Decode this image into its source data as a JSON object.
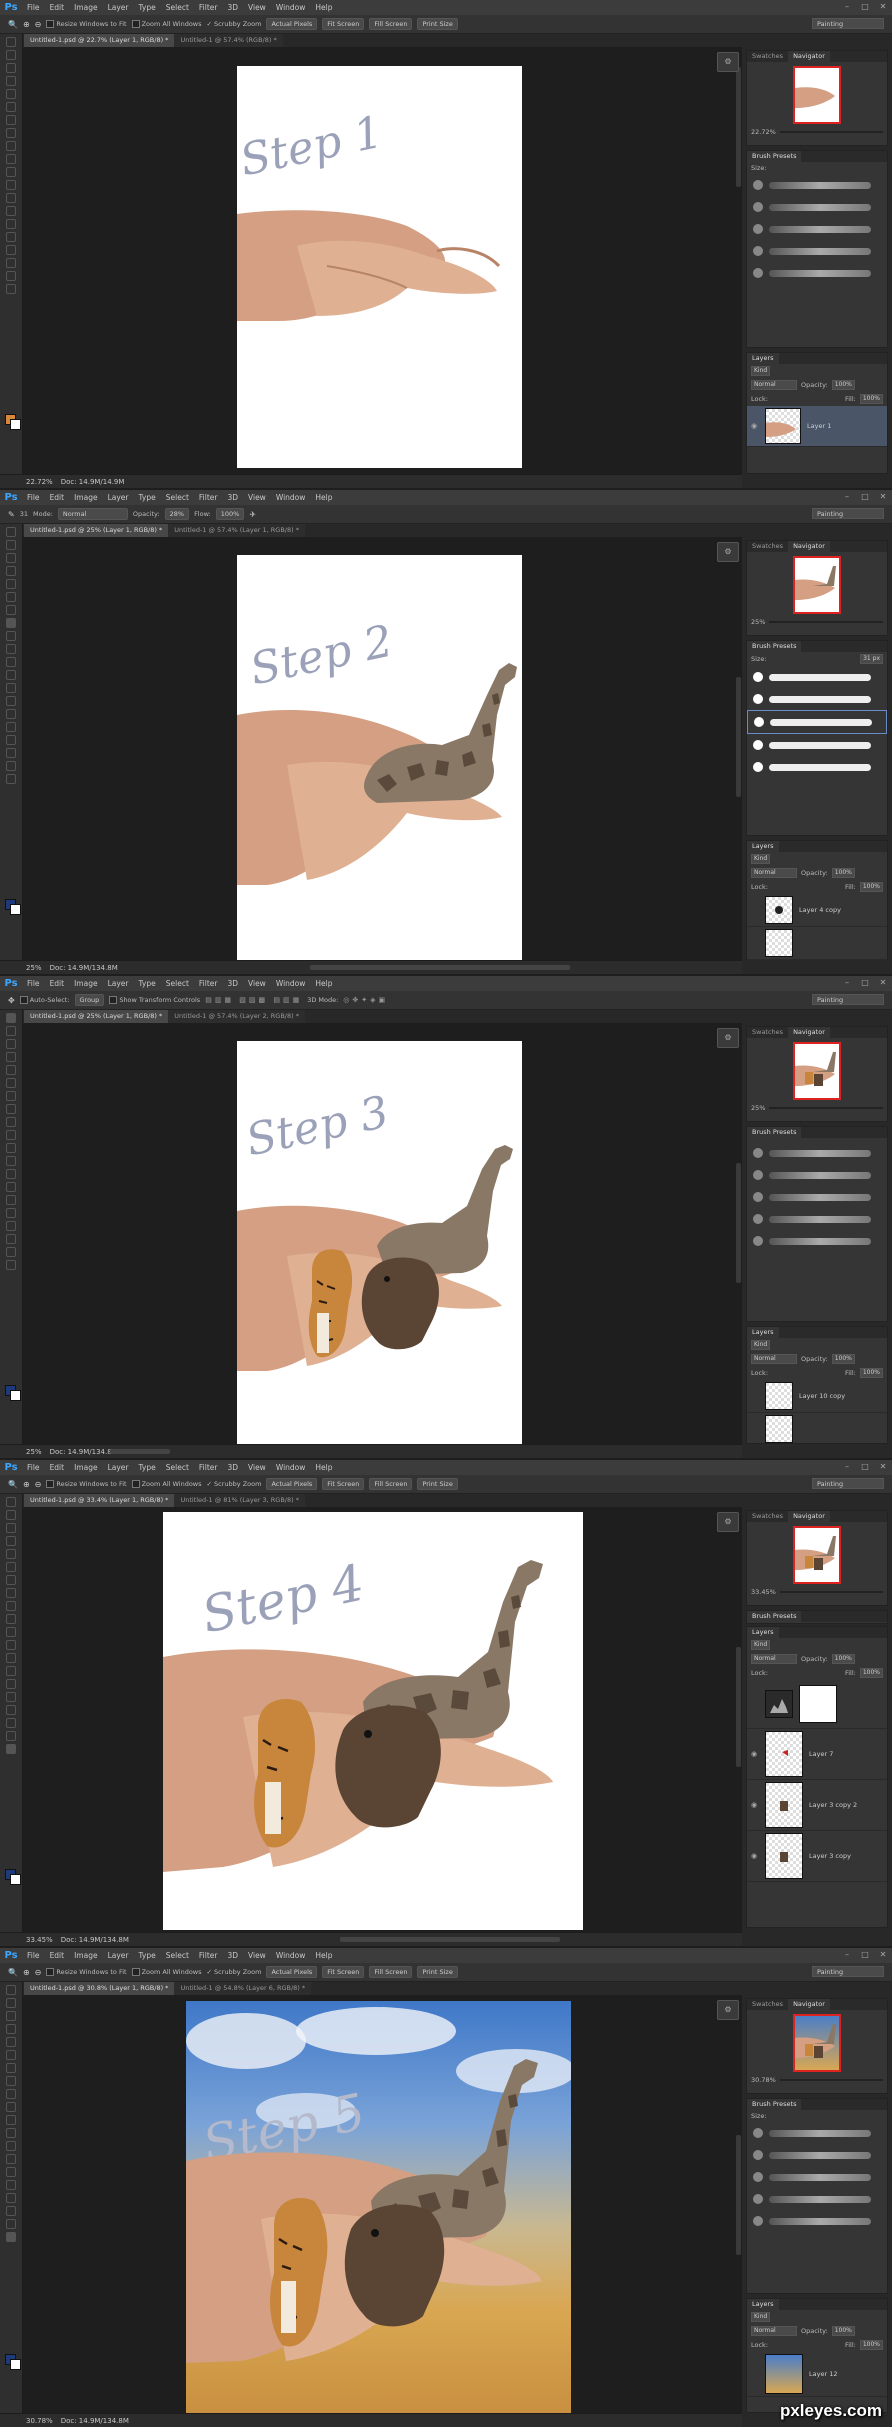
{
  "app": {
    "logo": "Ps",
    "menu": [
      "File",
      "Edit",
      "Image",
      "Layer",
      "Type",
      "Select",
      "Filter",
      "3D",
      "View",
      "Window",
      "Help"
    ],
    "workspace": "Painting",
    "window_controls": [
      "–",
      "□",
      "✕"
    ]
  },
  "options_bars": {
    "zoom": {
      "checks": [
        "Resize Windows to Fit",
        "Zoom All Windows",
        "Scrubby Zoom"
      ],
      "buttons": [
        "Actual Pixels",
        "Fit Screen",
        "Fill Screen",
        "Print Size"
      ]
    },
    "brush": {
      "size": "31",
      "mode_label": "Mode:",
      "mode": "Normal",
      "opacity_label": "Opacity:",
      "opacity": "28%",
      "flow_label": "Flow:",
      "flow": "100%"
    },
    "move": {
      "auto_select": "Auto-Select:",
      "group": "Group",
      "transform": "Show Transform Controls",
      "mode3d": "3D Mode:"
    }
  },
  "steps": [
    {
      "step_text": "Step 1",
      "tabs": [
        "Untitled-1.psd @ 22.7% (Layer 1, RGB/8) *",
        "Untitled-1 @ 57.4% (RGB/8) *"
      ],
      "zoom": "22.72%",
      "doc": "Doc: 14.9M/14.9M",
      "panel_tabs": [
        "Swatches",
        "Navigator"
      ],
      "nav_zoom": "22.72%",
      "brush_tab": "Brush Presets",
      "brush_size_label": "Size:",
      "brush_size": "",
      "layers_title": "Layers",
      "kind": "Kind",
      "blend": "Normal",
      "opacity_label": "Opacity:",
      "opacity": "100%",
      "lock": "Lock:",
      "fill_label": "Fill:",
      "fill": "100%",
      "layers": [
        "Layer 1"
      ]
    },
    {
      "step_text": "Step 2",
      "tabs": [
        "Untitled-1.psd @ 25% (Layer 1, RGB/8) *",
        "Untitled-1 @ 57.4% (Layer 1, RGB/8) *"
      ],
      "zoom": "25%",
      "doc": "Doc: 14.9M/134.8M",
      "panel_tabs": [
        "Swatches",
        "Navigator"
      ],
      "nav_zoom": "25%",
      "brush_tab": "Brush Presets",
      "brush_size_label": "Size:",
      "brush_size": "31 px",
      "layers_title": "Layers",
      "kind": "Kind",
      "blend": "Normal",
      "opacity_label": "Opacity:",
      "opacity": "100%",
      "lock": "Lock:",
      "fill_label": "Fill:",
      "fill": "100%",
      "layers": [
        "Layer 4 copy",
        ""
      ]
    },
    {
      "step_text": "Step 3",
      "tabs": [
        "Untitled-1.psd @ 25% (Layer 1, RGB/8) *",
        "Untitled-1 @ 57.4% (Layer 2, RGB/8) *"
      ],
      "zoom": "25%",
      "doc": "Doc: 14.9M/134.8M",
      "panel_tabs": [
        "Swatches",
        "Navigator"
      ],
      "nav_zoom": "25%",
      "brush_tab": "Brush Presets",
      "brush_size_label": "",
      "brush_size": "",
      "layers_title": "Layers",
      "kind": "Kind",
      "blend": "Normal",
      "opacity_label": "Opacity:",
      "opacity": "100%",
      "lock": "Lock:",
      "fill_label": "Fill:",
      "fill": "100%",
      "layers": [
        "Layer 10 copy",
        ""
      ]
    },
    {
      "step_text": "Step 4",
      "tabs": [
        "Untitled-1.psd @ 33.4% (Layer 1, RGB/8) *",
        "Untitled-1 @ 81% (Layer 3, RGB/8) *"
      ],
      "zoom": "33.45%",
      "doc": "Doc: 14.9M/134.8M",
      "panel_tabs": [
        "Swatches",
        "Navigator"
      ],
      "nav_zoom": "33.45%",
      "brush_tab": "Brush Presets",
      "brush_size_label": "",
      "brush_size": "",
      "layers_title": "Layers",
      "kind": "Kind",
      "blend": "Normal",
      "opacity_label": "Opacity:",
      "opacity": "100%",
      "lock": "Lock:",
      "fill_label": "Fill:",
      "fill": "100%",
      "layers": [
        "",
        "Layer 7",
        "Layer 3 copy 2",
        "Layer 3 copy"
      ]
    },
    {
      "step_text": "Step 5",
      "tabs": [
        "Untitled-1.psd @ 30.8% (Layer 1, RGB/8) *",
        "Untitled-1 @ 54.8% (Layer 6, RGB/8) *"
      ],
      "zoom": "30.78%",
      "doc": "Doc: 14.9M/134.8M",
      "panel_tabs": [
        "Swatches",
        "Navigator"
      ],
      "nav_zoom": "30.78%",
      "brush_tab": "Brush Presets",
      "brush_size_label": "Size:",
      "brush_size": "",
      "layers_title": "Layers",
      "kind": "Kind",
      "blend": "Normal",
      "opacity_label": "Opacity:",
      "opacity": "100%",
      "lock": "Lock:",
      "fill_label": "Fill:",
      "fill": "100%",
      "layers": [
        "Layer 12"
      ]
    }
  ],
  "watermark": "pxleyes.com",
  "colors": {
    "accent": "#3ea6ff",
    "nav_frame": "#dd2222",
    "hand": "#dba88b",
    "giraffe": "#8a7866",
    "tiger": "#c8863c",
    "bear": "#5a4535"
  }
}
